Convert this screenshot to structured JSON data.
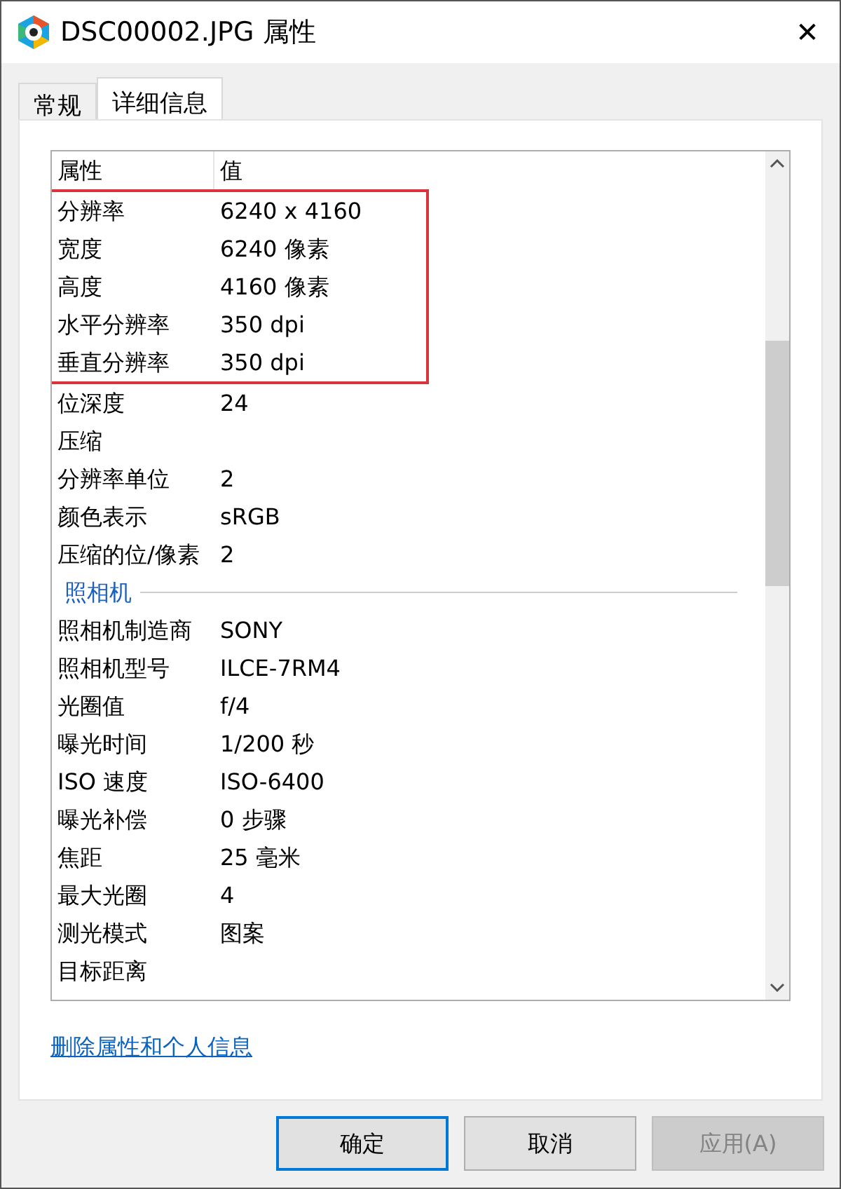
{
  "window": {
    "title": "DSC00002.JPG 属性",
    "close": "✕"
  },
  "tabs": [
    {
      "label": "常规",
      "selected": false
    },
    {
      "label": "详细信息",
      "selected": true
    }
  ],
  "table": {
    "columns": [
      "属性",
      "值"
    ],
    "rows": [
      {
        "kind": "property",
        "name": "分辨率",
        "value": "6240 x 4160",
        "highlighted": true
      },
      {
        "kind": "property",
        "name": "宽度",
        "value": "6240 像素",
        "highlighted": true
      },
      {
        "kind": "property",
        "name": "高度",
        "value": "4160 像素",
        "highlighted": true
      },
      {
        "kind": "property",
        "name": "水平分辨率",
        "value": "350 dpi",
        "highlighted": true
      },
      {
        "kind": "property",
        "name": "垂直分辨率",
        "value": "350 dpi",
        "highlighted": true
      },
      {
        "kind": "property",
        "name": "位深度",
        "value": "24",
        "highlighted": false
      },
      {
        "kind": "property",
        "name": "压缩",
        "value": "",
        "highlighted": false
      },
      {
        "kind": "property",
        "name": "分辨率单位",
        "value": "2",
        "highlighted": false
      },
      {
        "kind": "property",
        "name": "颜色表示",
        "value": "sRGB",
        "highlighted": false
      },
      {
        "kind": "property",
        "name": "压缩的位/像素",
        "value": "2",
        "highlighted": false
      },
      {
        "kind": "group",
        "name": "照相机"
      },
      {
        "kind": "property",
        "name": "照相机制造商",
        "value": "SONY",
        "highlighted": false
      },
      {
        "kind": "property",
        "name": "照相机型号",
        "value": "ILCE-7RM4",
        "highlighted": false
      },
      {
        "kind": "property",
        "name": "光圈值",
        "value": "f/4",
        "highlighted": false
      },
      {
        "kind": "property",
        "name": "曝光时间",
        "value": "1/200 秒",
        "highlighted": false
      },
      {
        "kind": "property",
        "name": "ISO 速度",
        "value": "ISO-6400",
        "highlighted": false
      },
      {
        "kind": "property",
        "name": "曝光补偿",
        "value": "0 步骤",
        "highlighted": false
      },
      {
        "kind": "property",
        "name": "焦距",
        "value": "25 毫米",
        "highlighted": false
      },
      {
        "kind": "property",
        "name": "最大光圈",
        "value": "4",
        "highlighted": false
      },
      {
        "kind": "property",
        "name": "测光模式",
        "value": "图案",
        "highlighted": false
      },
      {
        "kind": "property",
        "name": "目标距离",
        "value": "",
        "highlighted": false
      }
    ]
  },
  "link": "删除属性和个人信息",
  "buttons": [
    {
      "label": "确定",
      "disabled": false,
      "default": true
    },
    {
      "label": "取消",
      "disabled": false,
      "default": false
    },
    {
      "label": "应用(A)",
      "disabled": true,
      "default": false
    }
  ]
}
